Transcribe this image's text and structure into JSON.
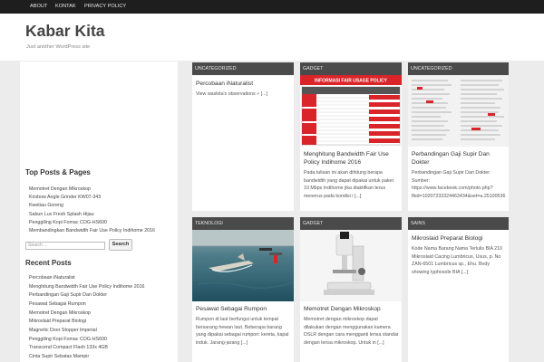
{
  "nav": {
    "items": [
      "ABOUT",
      "KONTAK",
      "PRIVACY POLICY"
    ]
  },
  "site": {
    "title": "Kabar Kita",
    "tagline": "Just another WordPress site"
  },
  "sidebar": {
    "top_posts_title": "Top Posts & Pages",
    "top_posts": [
      "Memotret Dengan Mikroskop",
      "Krisbow Angle Grinder KW07-343",
      "Kwetiau Goreng",
      "Sabun Lux Fresh Splash Hijau",
      "Penggiling Kopi Fomac COG-HS600",
      "Membandingkan Bandwidth Fair Use Policy Indihome 2016"
    ],
    "search_placeholder": "Search ...",
    "search_button": "Search",
    "recent_title": "Recent Posts",
    "recent_posts": [
      "Percobaan iNaturalist",
      "Menghitung Bandwidth Fair Use Policy Indihome 2016",
      "Perbandingan Gaji Supir Dan Dokter",
      "Pesawat Sebagai Rumpon",
      "Memotret Dengan Mikroskop",
      "Mikroslaid Preparat Biologi",
      "Magnetic Door Stopper Imperial",
      "Penggiling Kopi Fomac COG-HS600",
      "Transcend Compact Flash 133x 4GB",
      "Cinta Supir Sebatas Mampir"
    ]
  },
  "posts": [
    {
      "category": "UNCATEGORIZED",
      "title": "Percobaan iNaturalist",
      "excerpt": "View waskita's observations » [...]"
    },
    {
      "category": "GADGET",
      "thumb_heading": "INFORMASI FAIR USAGE POLICY",
      "title": "Menghitung Bandwidth Fair Use Policy Indihome 2016",
      "excerpt": "Pada tulisan ini akan dihitung berapa bandwidth yang dapat dipakai untuk paket 10 Mbps Indihome jika diaktifkan terus menerus pada kondisi i [...]"
    },
    {
      "category": "UNCATEGORIZED",
      "title": "Perbandingan Gaji Supir Dan Dokter",
      "excerpt": "Perbandingan Gaji Supir Dan Dokter Sumber: https://www.facebook.com/photo.php?fbid=10207233324463434&set=a.25100536"
    },
    {
      "category": "TEKNOLOGI",
      "title": "Pesawat Sebagai Rumpon",
      "excerpt": "Rumpon di laut berfungsi untuk tempat bersarang hewan laut. Beberapa barang yang dipakai sebagai rumpon: kereta, kapal induk. Jarang-jarang [...]"
    },
    {
      "category": "GADGET",
      "title": "Memotret Dengan Mikroskop",
      "excerpt": "Memotret dengan mikroskop dapat dilakukan dengan menggunakan kamera DSLR dengan cara mengganti lensa standar dengan lensa mikroskop. Untuk in [...]"
    },
    {
      "category": "SAINS",
      "title": "Mikroslaid Preparat Biologi",
      "excerpt": "Kode Nama Barang Nama Terlulis BIA 210 Mikroslaid Cacing Lumbricus, Usus, p. No ZAN-6501 Lumbricus sp., Ehu. Body showing typhosole BIA [...]"
    }
  ],
  "colors": {
    "topbar": "#1e1e1e",
    "category_bar": "#4a4a4a",
    "fup_red": "#d9252a"
  }
}
